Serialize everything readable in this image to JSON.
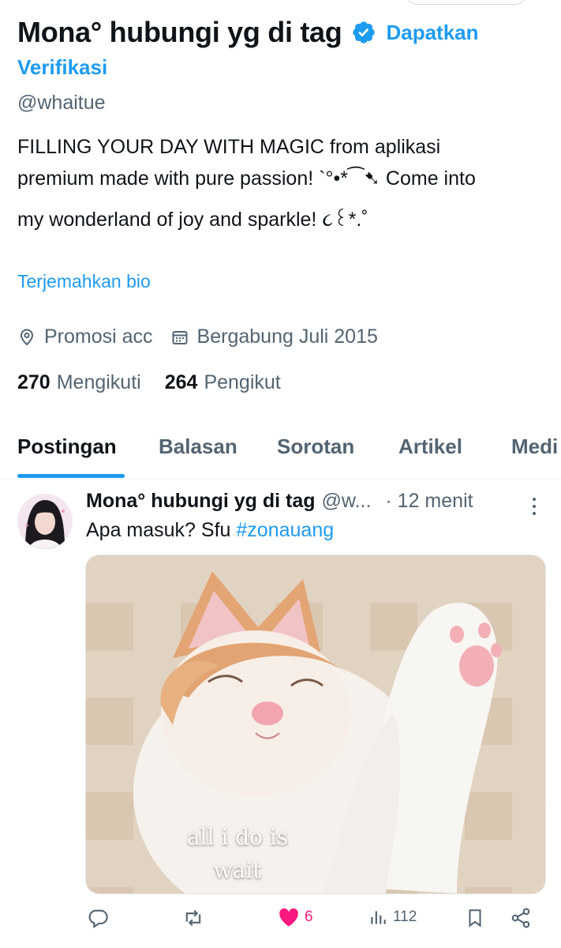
{
  "profile": {
    "name": "Mona° hubungi yg di tag",
    "get_verified_line1": "Dapatkan",
    "get_verified_line2": "Verifikasi",
    "handle": "@whaitue",
    "bio_line1": "FILLING YOUR DAY WITH MAGIC from aplikasi",
    "bio_line2": "premium made with pure passion! `°•*⁀➷ Come into",
    "bio_line3": "my wonderland of joy and sparkle! ૮꒰*.˚",
    "translate_bio": "Terjemahkan bio",
    "location": "Promosi acc",
    "joined": "Bergabung Juli 2015",
    "following_count": "270",
    "following_label": "Mengikuti",
    "followers_count": "264",
    "followers_label": "Pengikut"
  },
  "tabs": [
    "Postingan",
    "Balasan",
    "Sorotan",
    "Artikel",
    "Medi"
  ],
  "post": {
    "author": "Mona° hubungi yg di tag",
    "handle": "@w...",
    "time": "· 12 menit",
    "text": "Apa masuk? Sfu ",
    "hashtag": "#zonauang",
    "image_caption_line1": "all i do is",
    "image_caption_line2": "wait",
    "likes": "6",
    "views": "112"
  },
  "icons": {
    "verified": "verified-badge-icon",
    "location": "location-pin-icon",
    "calendar": "calendar-icon",
    "reply": "reply-icon",
    "repost": "repost-icon",
    "like": "heart-icon",
    "views": "views-icon",
    "bookmark": "bookmark-icon",
    "share": "share-icon",
    "more": "more-icon"
  },
  "colors": {
    "accent": "#1d9bf0",
    "like": "#f91880",
    "secondary": "#536471"
  }
}
